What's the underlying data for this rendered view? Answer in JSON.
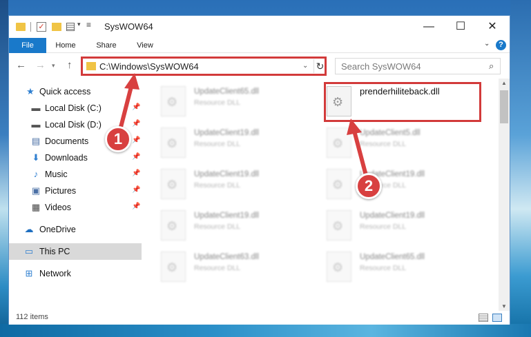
{
  "window": {
    "title": "SysWOW64",
    "minimize_glyph": "—",
    "maximize_glyph": "☐",
    "close_glyph": "✕"
  },
  "ribbon": {
    "tabs": [
      {
        "label": "File"
      },
      {
        "label": "Home"
      },
      {
        "label": "Share"
      },
      {
        "label": "View"
      }
    ],
    "help_glyph": "?"
  },
  "address": {
    "path": "C:\\Windows\\SysWOW64",
    "refresh_glyph": "↻"
  },
  "search": {
    "placeholder": "Search SysWOW64"
  },
  "sidebar": {
    "items": [
      {
        "label": "Quick access",
        "icon": "star-icon",
        "glyph": "★",
        "color": "#2f7fd0"
      },
      {
        "label": "Local Disk (C:)",
        "icon": "drive-icon",
        "glyph": "▬",
        "color": "#555555"
      },
      {
        "label": "Local Disk (D:)",
        "icon": "drive-icon",
        "glyph": "▬",
        "color": "#555555"
      },
      {
        "label": "Documents",
        "icon": "documents-icon",
        "glyph": "▤",
        "color": "#4a6fa5"
      },
      {
        "label": "Downloads",
        "icon": "download-icon",
        "glyph": "⬇",
        "color": "#2f7fd0"
      },
      {
        "label": "Music",
        "icon": "music-icon",
        "glyph": "♪",
        "color": "#2f7fd0"
      },
      {
        "label": "Pictures",
        "icon": "pictures-icon",
        "glyph": "▣",
        "color": "#4a6fa5"
      },
      {
        "label": "Videos",
        "icon": "videos-icon",
        "glyph": "▦",
        "color": "#444444"
      },
      {
        "label": "OneDrive",
        "icon": "cloud-icon",
        "glyph": "☁",
        "color": "#1f6fc0"
      },
      {
        "label": "This PC",
        "icon": "computer-icon",
        "glyph": "▭",
        "color": "#2f7fd0"
      },
      {
        "label": "Network",
        "icon": "network-icon",
        "glyph": "⊞",
        "color": "#2f7fd0"
      }
    ]
  },
  "files": {
    "left_column": [
      {
        "name": "UpdateClient65.dll",
        "type": "Resource DLL"
      },
      {
        "name": "UpdateClient19.dll",
        "type": "Resource DLL"
      },
      {
        "name": "UpdateClient19.dll",
        "type": "Resource DLL"
      },
      {
        "name": "UpdateClient19.dll",
        "type": "Resource DLL"
      },
      {
        "name": "UpdateClient63.dll",
        "type": "Resource DLL"
      }
    ],
    "right_column": [
      {
        "name": "prenderhiliteback.dll",
        "type": ""
      },
      {
        "name": "UpdateClient5.dll",
        "type": "Resource DLL"
      },
      {
        "name": "UpdateClient19.dll",
        "type": "Resource DLL"
      },
      {
        "name": "UpdateClient19.dll",
        "type": "Resource DLL"
      },
      {
        "name": "UpdateClient65.dll",
        "type": "Resource DLL"
      }
    ]
  },
  "status": {
    "item_count": "112 items"
  },
  "callouts": {
    "first": "1",
    "second": "2"
  },
  "colors": {
    "accent": "#1979ca",
    "highlight": "#d23a3a"
  }
}
